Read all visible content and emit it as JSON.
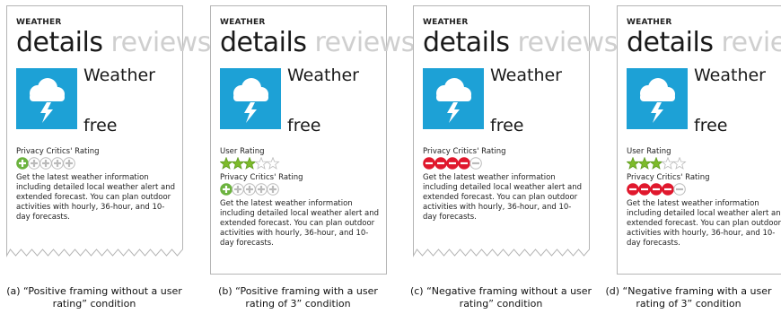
{
  "panels": [
    {
      "app_label": "WEATHER",
      "tab_active": "details",
      "tab_inactive": "reviews",
      "app_name": "Weather",
      "price": "free",
      "user_rating_label": "",
      "user_rating_stars": 0,
      "privacy_label": "Privacy Critics' Rating",
      "privacy_type": "positive",
      "privacy_filled": 1,
      "description": "Get the latest weather information including detailed local weather alert and extended forecast. You can plan outdoor activities with hourly, 36-hour, and 10-day forecasts.",
      "caption": "(a) “Positive framing without a user rating” condition"
    },
    {
      "app_label": "WEATHER",
      "tab_active": "details",
      "tab_inactive": "reviews",
      "app_name": "Weather",
      "price": "free",
      "user_rating_label": "User Rating",
      "user_rating_stars": 3,
      "privacy_label": "Privacy Critics' Rating",
      "privacy_type": "positive",
      "privacy_filled": 1,
      "description": "Get the latest weather information including detailed local weather alert and extended forecast. You can plan outdoor activities with hourly, 36-hour, and 10-day forecasts.",
      "caption": "(b) “Positive framing with a user rating of 3” condition"
    },
    {
      "app_label": "WEATHER",
      "tab_active": "details",
      "tab_inactive": "reviews",
      "app_name": "Weather",
      "price": "free",
      "user_rating_label": "",
      "user_rating_stars": 0,
      "privacy_label": "Privacy Critics' Rating",
      "privacy_type": "negative",
      "privacy_filled": 4,
      "description": "Get the latest weather information including detailed local weather alert and extended forecast. You can plan outdoor activities with hourly, 36-hour, and 10-day forecasts.",
      "caption": "(c) “Negative framing without a user rating” condition"
    },
    {
      "app_label": "WEATHER",
      "tab_active": "details",
      "tab_inactive": "reviews",
      "app_name": "Weather",
      "price": "free",
      "user_rating_label": "User Rating",
      "user_rating_stars": 3,
      "privacy_label": "Privacy Critics' Rating",
      "privacy_type": "negative",
      "privacy_filled": 4,
      "description": "Get the latest weather information including detailed local weather alert and extended forecast. You can plan outdoor activities with hourly, 36-hour, and 10-day forecasts.",
      "caption": "(d) “Negative framing with a user rating of 3” condition"
    }
  ],
  "colors": {
    "tile": "#1da1d6",
    "positive": "#6cb33f",
    "negative": "#e0182d",
    "star": "#7dbb2a",
    "empty": "#bbbbbb"
  },
  "icons": {
    "app_icon": "cloud-lightning-icon"
  }
}
